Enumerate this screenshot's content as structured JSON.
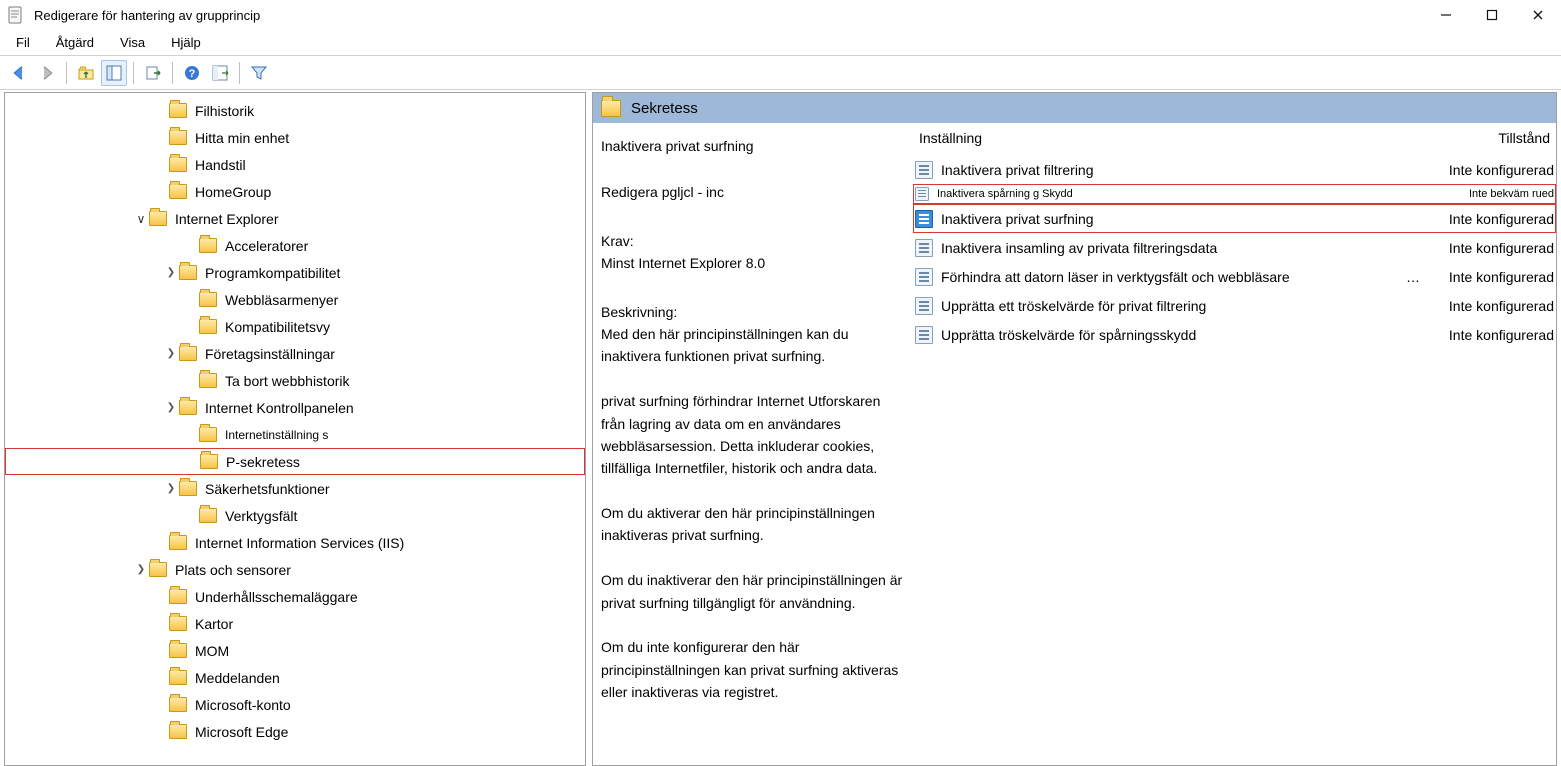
{
  "window": {
    "title": "Redigerare för hantering av grupprincip"
  },
  "menu": {
    "file": "Fil",
    "action": "Åtgärd",
    "view": "Visa",
    "help": "Hjälp"
  },
  "tree": [
    {
      "label": "Filhistorik",
      "depth": "d1",
      "tw": "none"
    },
    {
      "label": "Hitta min enhet",
      "depth": "d1",
      "tw": "none"
    },
    {
      "label": "Handstil",
      "depth": "d1",
      "tw": "none"
    },
    {
      "label": "HomeGroup",
      "depth": "d1",
      "tw": "none"
    },
    {
      "label": "Internet Explorer",
      "depth": "d2",
      "tw": "open"
    },
    {
      "label": "Acceleratorer",
      "depth": "d4",
      "tw": "none"
    },
    {
      "label": "Programkompatibilitet",
      "depth": "d3",
      "tw": "closed"
    },
    {
      "label": "Webbläsarmenyer",
      "depth": "d4",
      "tw": "none"
    },
    {
      "label": "Kompatibilitetsvy",
      "depth": "d4",
      "tw": "none"
    },
    {
      "label": "Företagsinställningar",
      "depth": "d3",
      "tw": "closed"
    },
    {
      "label": "Ta bort webbhistorik",
      "depth": "d4",
      "tw": "none"
    },
    {
      "label": "Internet Kontrollpanelen",
      "depth": "d3",
      "tw": "closed"
    },
    {
      "label": "Internetinställning s",
      "depth": "d4",
      "tw": "none",
      "small": true
    },
    {
      "label": "P-sekretess",
      "depth": "d4",
      "tw": "none",
      "red": true
    },
    {
      "label": "Säkerhetsfunktioner",
      "depth": "d3",
      "tw": "closed"
    },
    {
      "label": "Verktygsfält",
      "depth": "d4",
      "tw": "none"
    },
    {
      "label": "Internet Information Services (IIS)",
      "depth": "d1",
      "tw": "none"
    },
    {
      "label": "Plats och sensorer",
      "depth": "d2",
      "tw": "closed"
    },
    {
      "label": "Underhållsschemaläggare",
      "depth": "d1",
      "tw": "none"
    },
    {
      "label": "Kartor",
      "depth": "d1",
      "tw": "none"
    },
    {
      "label": "MOM",
      "depth": "d1",
      "tw": "none"
    },
    {
      "label": "Meddelanden",
      "depth": "d1",
      "tw": "none"
    },
    {
      "label": "Microsoft-konto",
      "depth": "d1",
      "tw": "none"
    },
    {
      "label": "Microsoft Edge",
      "depth": "d1",
      "tw": "none"
    }
  ],
  "details": {
    "folder_title": "Sekretess",
    "selected_title": "Inaktivera privat surfning",
    "edit_label": "Redigera pgljcl - inc",
    "requirements_label": "Krav:",
    "requirements_value": "Minst Internet Explorer 8.0",
    "description_label": "Beskrivning:",
    "description": "Med den här principinställningen kan du inaktivera funktionen privat surfning.\n\nprivat surfning förhindrar Internet Utforskaren från lagring av data om en användares webbläsarsession. Detta inkluderar cookies, tillfälliga Internetfiler, historik och andra data.\n\nOm du aktiverar den här principinställningen inaktiveras privat surfning.\n\nOm du inaktiverar den här principinställningen är privat surfning tillgängligt för användning.\n\nOm du inte konfigurerar den här principinställningen kan privat surfning aktiveras eller inaktiveras via registret."
  },
  "columns": {
    "setting": "Inställning",
    "state": "Tillstånd"
  },
  "rows": [
    {
      "text": "Inaktivera privat filtrering",
      "state": "Inte konfigurerad"
    },
    {
      "text": "Inaktivera spårning    g  Skydd",
      "state": "Inte bekväm rued",
      "squashed": true,
      "red": true,
      "dash": true
    },
    {
      "text": "Inaktivera privat surfning",
      "state": "Inte konfigurerad",
      "selected": true,
      "red": true
    },
    {
      "text": "Inaktivera insamling av privata filtreringsdata",
      "state": "Inte konfigurerad"
    },
    {
      "text": "Förhindra att datorn läser in verktygsfält och webbläsare",
      "state": "Inte konfigurerad",
      "ellipsis": true
    },
    {
      "text": "Upprätta ett tröskelvärde för privat filtrering",
      "state": "Inte konfigurerad"
    },
    {
      "text": "Upprätta tröskelvärde för spårningsskydd",
      "state": "Inte konfigurerad"
    }
  ]
}
